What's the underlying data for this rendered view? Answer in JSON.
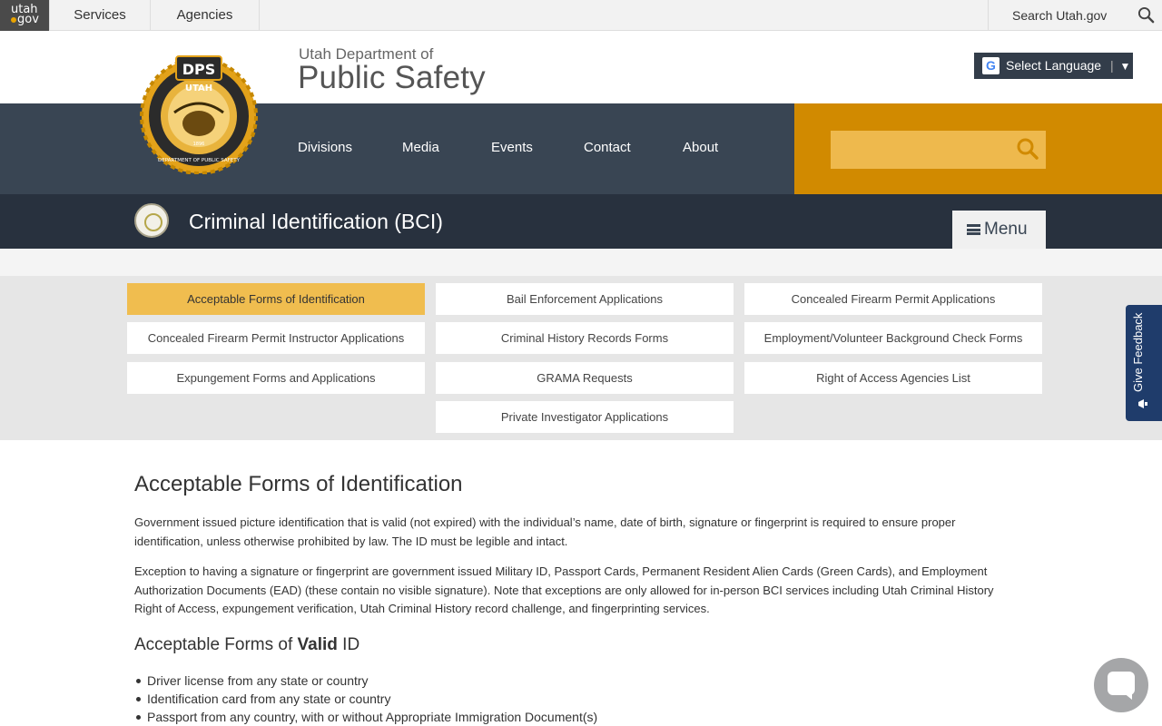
{
  "utah_bar": {
    "logo_top": "utah",
    "logo_bottom": "gov",
    "services": "Services",
    "agencies": "Agencies",
    "search_label": "Search Utah.gov"
  },
  "header": {
    "seal_top_text": "DPS",
    "seal_band_text": "UTAH",
    "seal_ring_text": "DEPARTMENT OF PUBLIC SAFETY",
    "seal_year": "1896",
    "dept_small": "Utah Department of",
    "dept_big": "Public Safety",
    "language_button": "Select Language",
    "language_arrow": "▼"
  },
  "nav": {
    "items": [
      "Divisions",
      "Media",
      "Events",
      "Contact",
      "About"
    ],
    "search_placeholder": ""
  },
  "division": {
    "title": "Criminal Identification (BCI)",
    "menu_label": "Menu"
  },
  "submenu": {
    "items": [
      "Acceptable Forms of Identification",
      "Bail Enforcement Applications",
      "Concealed Firearm Permit Applications",
      "Concealed Firearm Permit Instructor Applications",
      "Criminal History Records Forms",
      "Employment/Volunteer Background Check Forms",
      "Expungement Forms and Applications",
      "GRAMA Requests",
      "Right of Access Agencies List",
      "Private Investigator Applications"
    ],
    "active_index": 0
  },
  "content": {
    "heading": "Acceptable Forms of Identification",
    "paragraph1": "Government issued picture identification that is valid (not expired) with the individual’s name, date of birth, signature or fingerprint is required to ensure proper identification, unless otherwise prohibited by law. The ID must be legible and intact.",
    "paragraph2": "Exception to having a signature or fingerprint are government issued Military ID, Passport Cards, Permanent Resident Alien Cards (Green Cards), and Employment Authorization Documents (EAD) (these contain no visible signature). Note that exceptions are only allowed for in-person BCI services including Utah Criminal History Right of Access, expungement verification, Utah Criminal History record challenge, and fingerprinting services.",
    "subheading_pre": "Acceptable Forms of ",
    "subheading_bold": "Valid",
    "subheading_post": " ID",
    "list": [
      "Driver license from any state or country",
      "Identification card from any state or country",
      "Passport from any country, with or without Appropriate Immigration Document(s)"
    ]
  },
  "feedback": {
    "label": "Give Feedback"
  },
  "colors": {
    "nav_dark": "#394553",
    "division_bar": "#28313e",
    "accent_orange": "#d18a00",
    "active_tab": "#f0bd4f",
    "feedback_blue": "#1f3c6b"
  }
}
